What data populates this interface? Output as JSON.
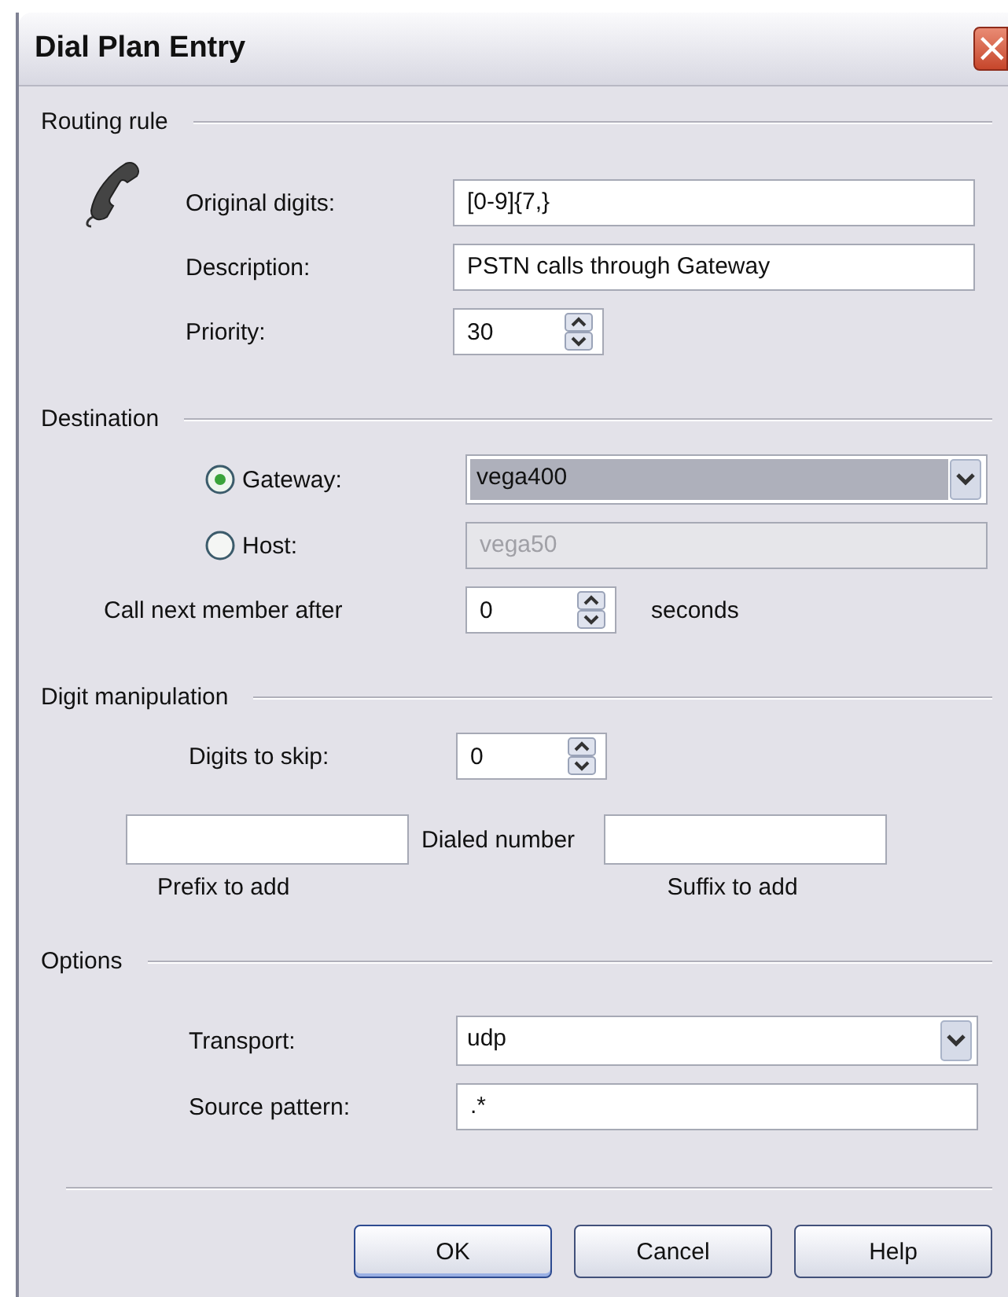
{
  "window": {
    "title": "Dial Plan Entry",
    "close": "×"
  },
  "routing_rule": {
    "heading": "Routing rule",
    "fields": [
      {
        "kind": "text",
        "label": "Original digits:",
        "value": "[0-9]{7,}"
      },
      {
        "kind": "text",
        "label": "Description:",
        "value": "PSTN calls through Gateway"
      },
      {
        "kind": "spinner",
        "label": "Priority:",
        "value": "30"
      }
    ]
  },
  "destination": {
    "heading": "Destination",
    "options": [
      {
        "kind": "dropdown",
        "label": "Gateway:",
        "selected": true,
        "value": "vega400"
      },
      {
        "kind": "text",
        "label": "Host:",
        "selected": false,
        "value": "vega50"
      }
    ],
    "call_next": {
      "label": "Call next member after",
      "value": "0",
      "unit": "seconds"
    }
  },
  "digit_manipulation": {
    "heading": "Digit manipulation",
    "digits_to_skip": {
      "label": "Digits to skip:",
      "value": "0"
    },
    "middle_label": "Dialed number",
    "prefix_label": "Prefix to add",
    "suffix_label": "Suffix to add"
  },
  "options": {
    "heading": "Options",
    "fields": [
      {
        "kind": "dropdown",
        "label": "Transport:",
        "value": "udp"
      },
      {
        "kind": "text",
        "label": "Source pattern:",
        "value": ".*"
      }
    ]
  },
  "buttons": [
    {
      "label": "OK",
      "default": true
    },
    {
      "label": "Cancel",
      "default": false
    },
    {
      "label": "Help",
      "default": false
    }
  ]
}
